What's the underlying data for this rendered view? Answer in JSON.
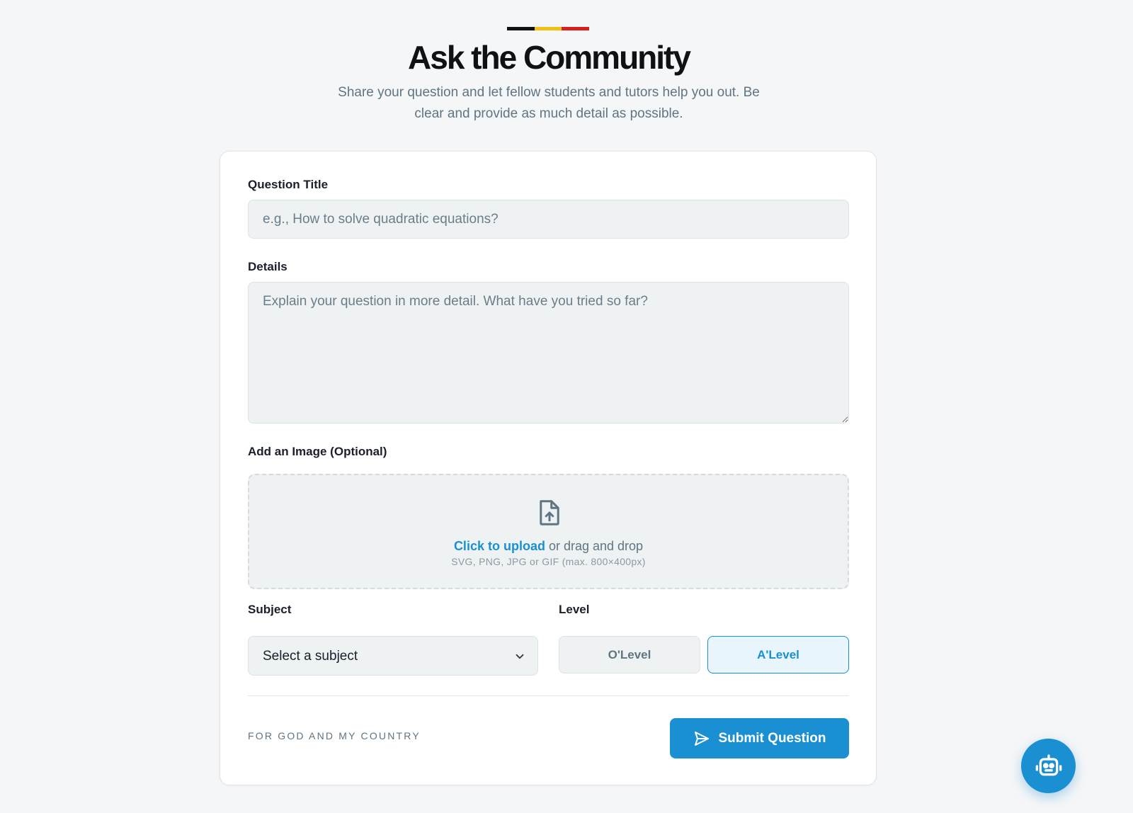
{
  "header": {
    "title": "Ask the Community",
    "subtitle": "Share your question and let fellow students and tutors help you out. Be clear and provide as much detail as possible.",
    "stripe_colors": [
      "#111111",
      "#f2c011",
      "#d92020"
    ]
  },
  "form": {
    "question_title": {
      "label": "Question Title",
      "placeholder": "e.g., How to solve quadratic equations?",
      "value": ""
    },
    "details": {
      "label": "Details",
      "placeholder": "Explain your question in more detail. What have you tried so far?",
      "value": ""
    },
    "image": {
      "label": "Add an Image (Optional)",
      "icon": "file-upload-icon",
      "link_text": "Click to upload",
      "rest_text": " or drag and drop",
      "hint": "SVG, PNG, JPG or GIF (max. 800×400px)"
    },
    "subject": {
      "label": "Subject",
      "selected": "Select a subject",
      "icon": "chevron-down-icon"
    },
    "level": {
      "label": "Level",
      "options": [
        "O'Level",
        "A'Level"
      ],
      "selected": "A'Level"
    }
  },
  "footer": {
    "motto": "FOR GOD AND MY COUNTRY",
    "submit_label": "Submit Question",
    "submit_icon": "send-icon"
  },
  "fab": {
    "icon": "robot-icon"
  },
  "colors": {
    "accent": "#1a8fd1",
    "background": "#f5f6f8",
    "field_bg": "#eff2f3"
  }
}
